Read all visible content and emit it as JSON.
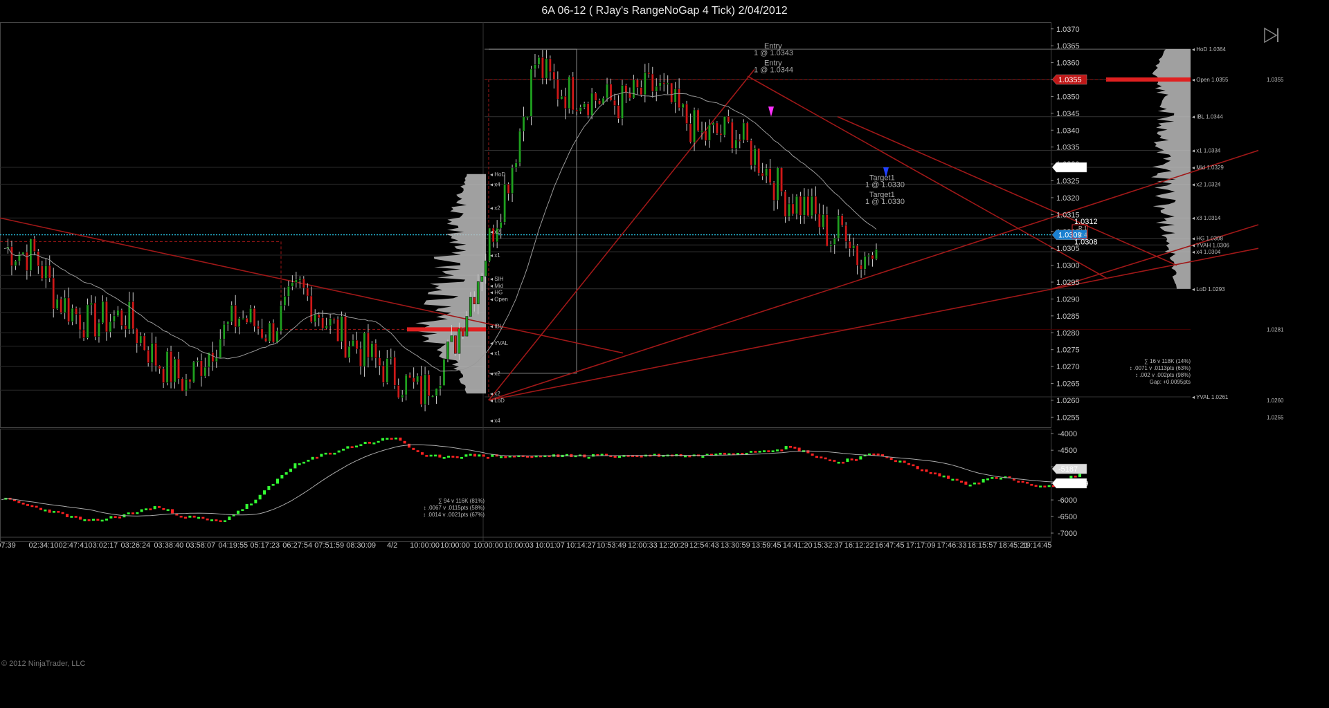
{
  "window": {
    "title": "6A 06-12 ( RJay's RangeNoGap  4 Tick)  2/04/2012"
  },
  "copyright": "© 2012 NinjaTrader, LLC",
  "colors": {
    "background": "#000000",
    "bull": "#1fa01f",
    "bear": "#d01818",
    "wick": "#cccccc",
    "trend": "#a01818",
    "dotted": "#28c8e8",
    "profile": "#bcbcbc",
    "poc": "#e02020",
    "lower_bull": "#33ff33",
    "lower_bear": "#ff2222"
  },
  "icons": {
    "play": "skip-forward-icon"
  },
  "axes": {
    "y_upper_ticks": [
      "1.0370",
      "1.0365",
      "1.0360",
      "1.0355",
      "1.0350",
      "1.0345",
      "1.0340",
      "1.0335",
      "1.0330",
      "1.0325",
      "1.0320",
      "1.0315",
      "1.0310",
      "1.0305",
      "1.0300",
      "1.0295",
      "1.0290",
      "1.0285",
      "1.0280",
      "1.0275",
      "1.0270",
      "1.0265",
      "1.0260",
      "1.0255"
    ],
    "y_lower_ticks": [
      "-4000",
      "-4500",
      "-5000",
      "-5500",
      "-6000",
      "-6500",
      "-7000"
    ],
    "x_ticks": [
      "07:39",
      "02:34:10",
      "02:47:41",
      "03:02:17",
      "03:26:24",
      "03:38:40",
      "03:58:07",
      "04:19:55",
      "05:17:23",
      "06:27:54",
      "07:51:59",
      "08:30:09",
      "4/2",
      "10:00:00",
      "10:00:00",
      "10:00:00",
      "10:00:03",
      "10:01:07",
      "10:14:27",
      "10:53:49",
      "12:00:33",
      "12:20:29",
      "12:54:43",
      "13:30:59",
      "13:59:45",
      "14:41:20",
      "15:32:37",
      "16:12:22",
      "16:47:45",
      "17:17:09",
      "17:46:33",
      "18:15:57",
      "18:45:21",
      "19:14:45"
    ]
  },
  "price_flags": {
    "open": "1.0355",
    "mid": "1.0329",
    "last": "1.0309",
    "lower_last": "-5373.29",
    "lower_value": "-5187"
  },
  "annotations": {
    "entry1": "Entry",
    "entry1_detail": "1 @ 1.0343",
    "entry2": "Entry",
    "entry2_detail": "1 @ 1.0344",
    "target1a": "Target1",
    "target1a_detail": "1 @ 1.0330",
    "target1b": "Target1",
    "target1b_detail": "1 @ 1.0330",
    "last_high": "1.0312",
    "last_low": "1.0308",
    "box_label1": "R:1",
    "box_label2": "C:4"
  },
  "left_levels": [
    "HoD",
    "x4",
    "x2",
    "x2",
    "x1",
    "SIH",
    "Mid",
    "HG",
    "Open",
    "IBL",
    "YVAL",
    "x1",
    "x2",
    "x2",
    "LoD",
    "x4"
  ],
  "right_levels": [
    {
      "label": "HoD 1.0364",
      "color": "#e8d060"
    },
    {
      "label": "Open 1.0355",
      "color": "#ff4040"
    },
    {
      "label": "IBL 1.0344",
      "color": "#e8a020"
    },
    {
      "label": "x1 1.0334",
      "color": "#cccccc"
    },
    {
      "label": "Mid 1.0329",
      "color": "#ffffff"
    },
    {
      "label": "x2 1.0324",
      "color": "#cccccc"
    },
    {
      "label": "x3 1.0314",
      "color": "#cccccc"
    },
    {
      "label": "HG 1.0308",
      "color": "#30d8e8"
    },
    {
      "label": "YVAH 1.0306",
      "color": "#4080e0"
    },
    {
      "label": "x4 1.0304",
      "color": "#cccccc"
    },
    {
      "label": "LoD 1.0293",
      "color": "#ffffff"
    },
    {
      "label": "YVAL 1.0261",
      "color": "#4080e0"
    }
  ],
  "right_small_labels": [
    "1.0355",
    "1.0281",
    "1.0260",
    "1.0255"
  ],
  "stats_left": [
    "∑ 94 v 116K (81%)",
    "↕ .0067 v .0115pts (58%)",
    "↕ .0014 v .0021pts (67%)"
  ],
  "stats_right": [
    "∑ 16 v 118K (14%)",
    "↕ .0071 v .0113pts (63%)",
    "↕ .002 v .002pts (98%)",
    "Gap: +0.0095pts"
  ],
  "chart_data": [
    {
      "type": "candlestick",
      "title": "6A 06-12 ( RJay's RangeNoGap  4 Tick)  2/04/2012",
      "ylim": [
        1.0252,
        1.0372
      ],
      "y_ticks": [
        1.037,
        1.0365,
        1.036,
        1.0355,
        1.035,
        1.0345,
        1.034,
        1.0335,
        1.033,
        1.0325,
        1.032,
        1.0315,
        1.031,
        1.0305,
        1.03,
        1.0295,
        1.029,
        1.0285,
        1.028,
        1.0275,
        1.027,
        1.0265,
        1.026,
        1.0255
      ],
      "session_break": "4/2",
      "bar_count": 230,
      "closes_anchor": [
        {
          "bar": 0,
          "close": 1.0305
        },
        {
          "bar": 8,
          "close": 1.0303
        },
        {
          "bar": 14,
          "close": 1.029
        },
        {
          "bar": 22,
          "close": 1.0283
        },
        {
          "bar": 32,
          "close": 1.0285
        },
        {
          "bar": 40,
          "close": 1.0272
        },
        {
          "bar": 48,
          "close": 1.0265
        },
        {
          "bar": 56,
          "close": 1.0278
        },
        {
          "bar": 62,
          "close": 1.0285
        },
        {
          "bar": 70,
          "close": 1.028
        },
        {
          "bar": 78,
          "close": 1.0293
        },
        {
          "bar": 86,
          "close": 1.0282
        },
        {
          "bar": 94,
          "close": 1.0275
        },
        {
          "bar": 102,
          "close": 1.0268
        },
        {
          "bar": 110,
          "close": 1.0262
        },
        {
          "bar": 118,
          "close": 1.0275
        },
        {
          "bar": 126,
          "close": 1.03
        },
        {
          "bar": 134,
          "close": 1.033
        },
        {
          "bar": 140,
          "close": 1.036
        },
        {
          "bar": 146,
          "close": 1.0352
        },
        {
          "bar": 154,
          "close": 1.035
        },
        {
          "bar": 162,
          "close": 1.0348
        },
        {
          "bar": 172,
          "close": 1.0353
        },
        {
          "bar": 178,
          "close": 1.0345
        },
        {
          "bar": 184,
          "close": 1.0338
        },
        {
          "bar": 192,
          "close": 1.034
        },
        {
          "bar": 200,
          "close": 1.033
        },
        {
          "bar": 206,
          "close": 1.032
        },
        {
          "bar": 212,
          "close": 1.0317
        },
        {
          "bar": 218,
          "close": 1.0308
        },
        {
          "bar": 222,
          "close": 1.0312
        },
        {
          "bar": 226,
          "close": 1.03
        },
        {
          "bar": 230,
          "close": 1.031
        }
      ],
      "levels": [
        {
          "name": "HoD",
          "value": 1.0364
        },
        {
          "name": "Open",
          "value": 1.0355
        },
        {
          "name": "IBL",
          "value": 1.0344
        },
        {
          "name": "x1",
          "value": 1.0334
        },
        {
          "name": "Mid",
          "value": 1.0329
        },
        {
          "name": "x2",
          "value": 1.0324
        },
        {
          "name": "x3",
          "value": 1.0314
        },
        {
          "name": "HG",
          "value": 1.0308
        },
        {
          "name": "YVAH",
          "value": 1.0306
        },
        {
          "name": "x4",
          "value": 1.0304
        },
        {
          "name": "LoD",
          "value": 1.0293
        },
        {
          "name": "YVAL",
          "value": 1.0261
        }
      ],
      "last_price": 1.0309
    },
    {
      "type": "bar",
      "ylim": [
        -7250,
        -3850
      ],
      "y_ticks": [
        -4000,
        -4500,
        -5000,
        -5500,
        -6000,
        -6500,
        -7000
      ],
      "anchors": [
        {
          "bar": 0,
          "value": -5950
        },
        {
          "bar": 10,
          "value": -6300
        },
        {
          "bar": 20,
          "value": -6650
        },
        {
          "bar": 28,
          "value": -6450
        },
        {
          "bar": 35,
          "value": -6200
        },
        {
          "bar": 42,
          "value": -6500
        },
        {
          "bar": 50,
          "value": -6650
        },
        {
          "bar": 58,
          "value": -6000
        },
        {
          "bar": 66,
          "value": -5000
        },
        {
          "bar": 74,
          "value": -4600
        },
        {
          "bar": 82,
          "value": -4300
        },
        {
          "bar": 90,
          "value": -4100
        },
        {
          "bar": 96,
          "value": -4700
        },
        {
          "bar": 104,
          "value": -4650
        },
        {
          "bar": 120,
          "value": -4680
        },
        {
          "bar": 140,
          "value": -4650
        },
        {
          "bar": 160,
          "value": -4650
        },
        {
          "bar": 180,
          "value": -4400
        },
        {
          "bar": 190,
          "value": -4850
        },
        {
          "bar": 200,
          "value": -4600
        },
        {
          "bar": 210,
          "value": -5100
        },
        {
          "bar": 220,
          "value": -5500
        },
        {
          "bar": 228,
          "value": -5300
        },
        {
          "bar": 238,
          "value": -5650
        },
        {
          "bar": 246,
          "value": -5200
        }
      ],
      "last_value": -5187,
      "avg_value": -5373.29
    }
  ]
}
